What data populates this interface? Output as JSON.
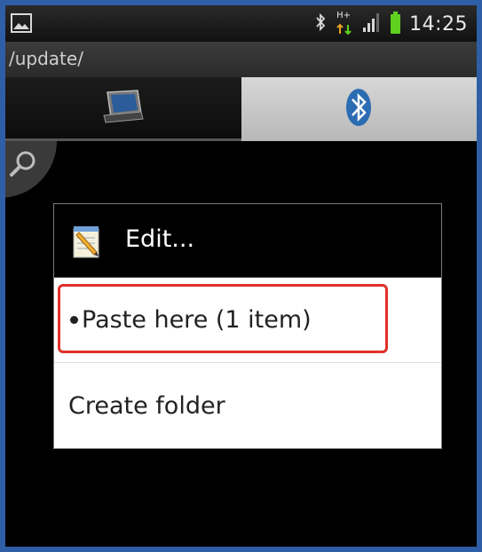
{
  "status_bar": {
    "time": "14:25",
    "network": "H+",
    "left_icon": "picture-icon",
    "icons": [
      "bluetooth-icon",
      "data-transfer-icon",
      "signal-icon",
      "battery-icon"
    ]
  },
  "path_bar": {
    "path": "/update/"
  },
  "tabs": [
    {
      "icon": "device-icon",
      "selected": true
    },
    {
      "icon": "bluetooth-icon",
      "selected": false
    }
  ],
  "dialog": {
    "title": "Edit...",
    "title_icon": "notepad-pencil-icon",
    "items": [
      {
        "label": "Paste here (1 item)",
        "bullet": true,
        "highlighted": true
      },
      {
        "label": "Create folder",
        "bullet": false
      }
    ]
  },
  "colors": {
    "frame_border": "#2e5fa6",
    "highlight": "#e0312a",
    "battery": "#5fd020",
    "bluetooth": "#2b6cb3"
  }
}
